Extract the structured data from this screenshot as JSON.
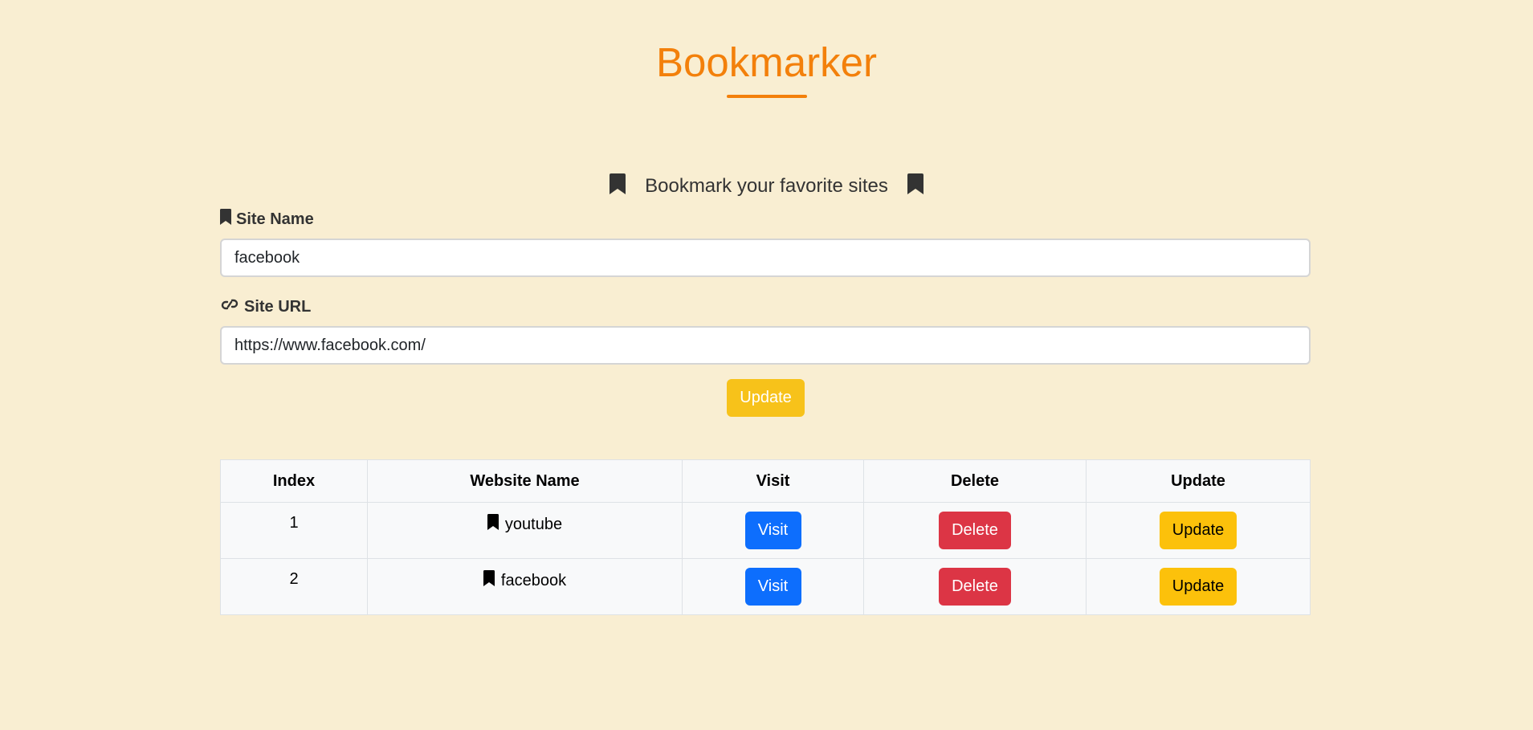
{
  "app": {
    "title": "Bookmarker",
    "subtitle": "Bookmark your favorite sites"
  },
  "form": {
    "site_name_label": "Site Name",
    "site_name_value": "facebook",
    "site_url_label": "Site URL",
    "site_url_value": "https://www.facebook.com/",
    "submit_label": "Update"
  },
  "table": {
    "headers": [
      "Index",
      "Website Name",
      "Visit",
      "Delete",
      "Update"
    ],
    "rows": [
      {
        "index": "1",
        "name": "youtube",
        "visit": "Visit",
        "delete": "Delete",
        "update": "Update"
      },
      {
        "index": "2",
        "name": "facebook",
        "visit": "Visit",
        "delete": "Delete",
        "update": "Update"
      }
    ]
  },
  "colors": {
    "background": "#f9eed2",
    "accent": "#f3800b",
    "update_button": "#fcc10b",
    "visit_button": "#0d6efd",
    "delete_button": "#dc3545"
  },
  "icons": {
    "bookmark": "bookmark-icon",
    "link": "link-icon"
  }
}
